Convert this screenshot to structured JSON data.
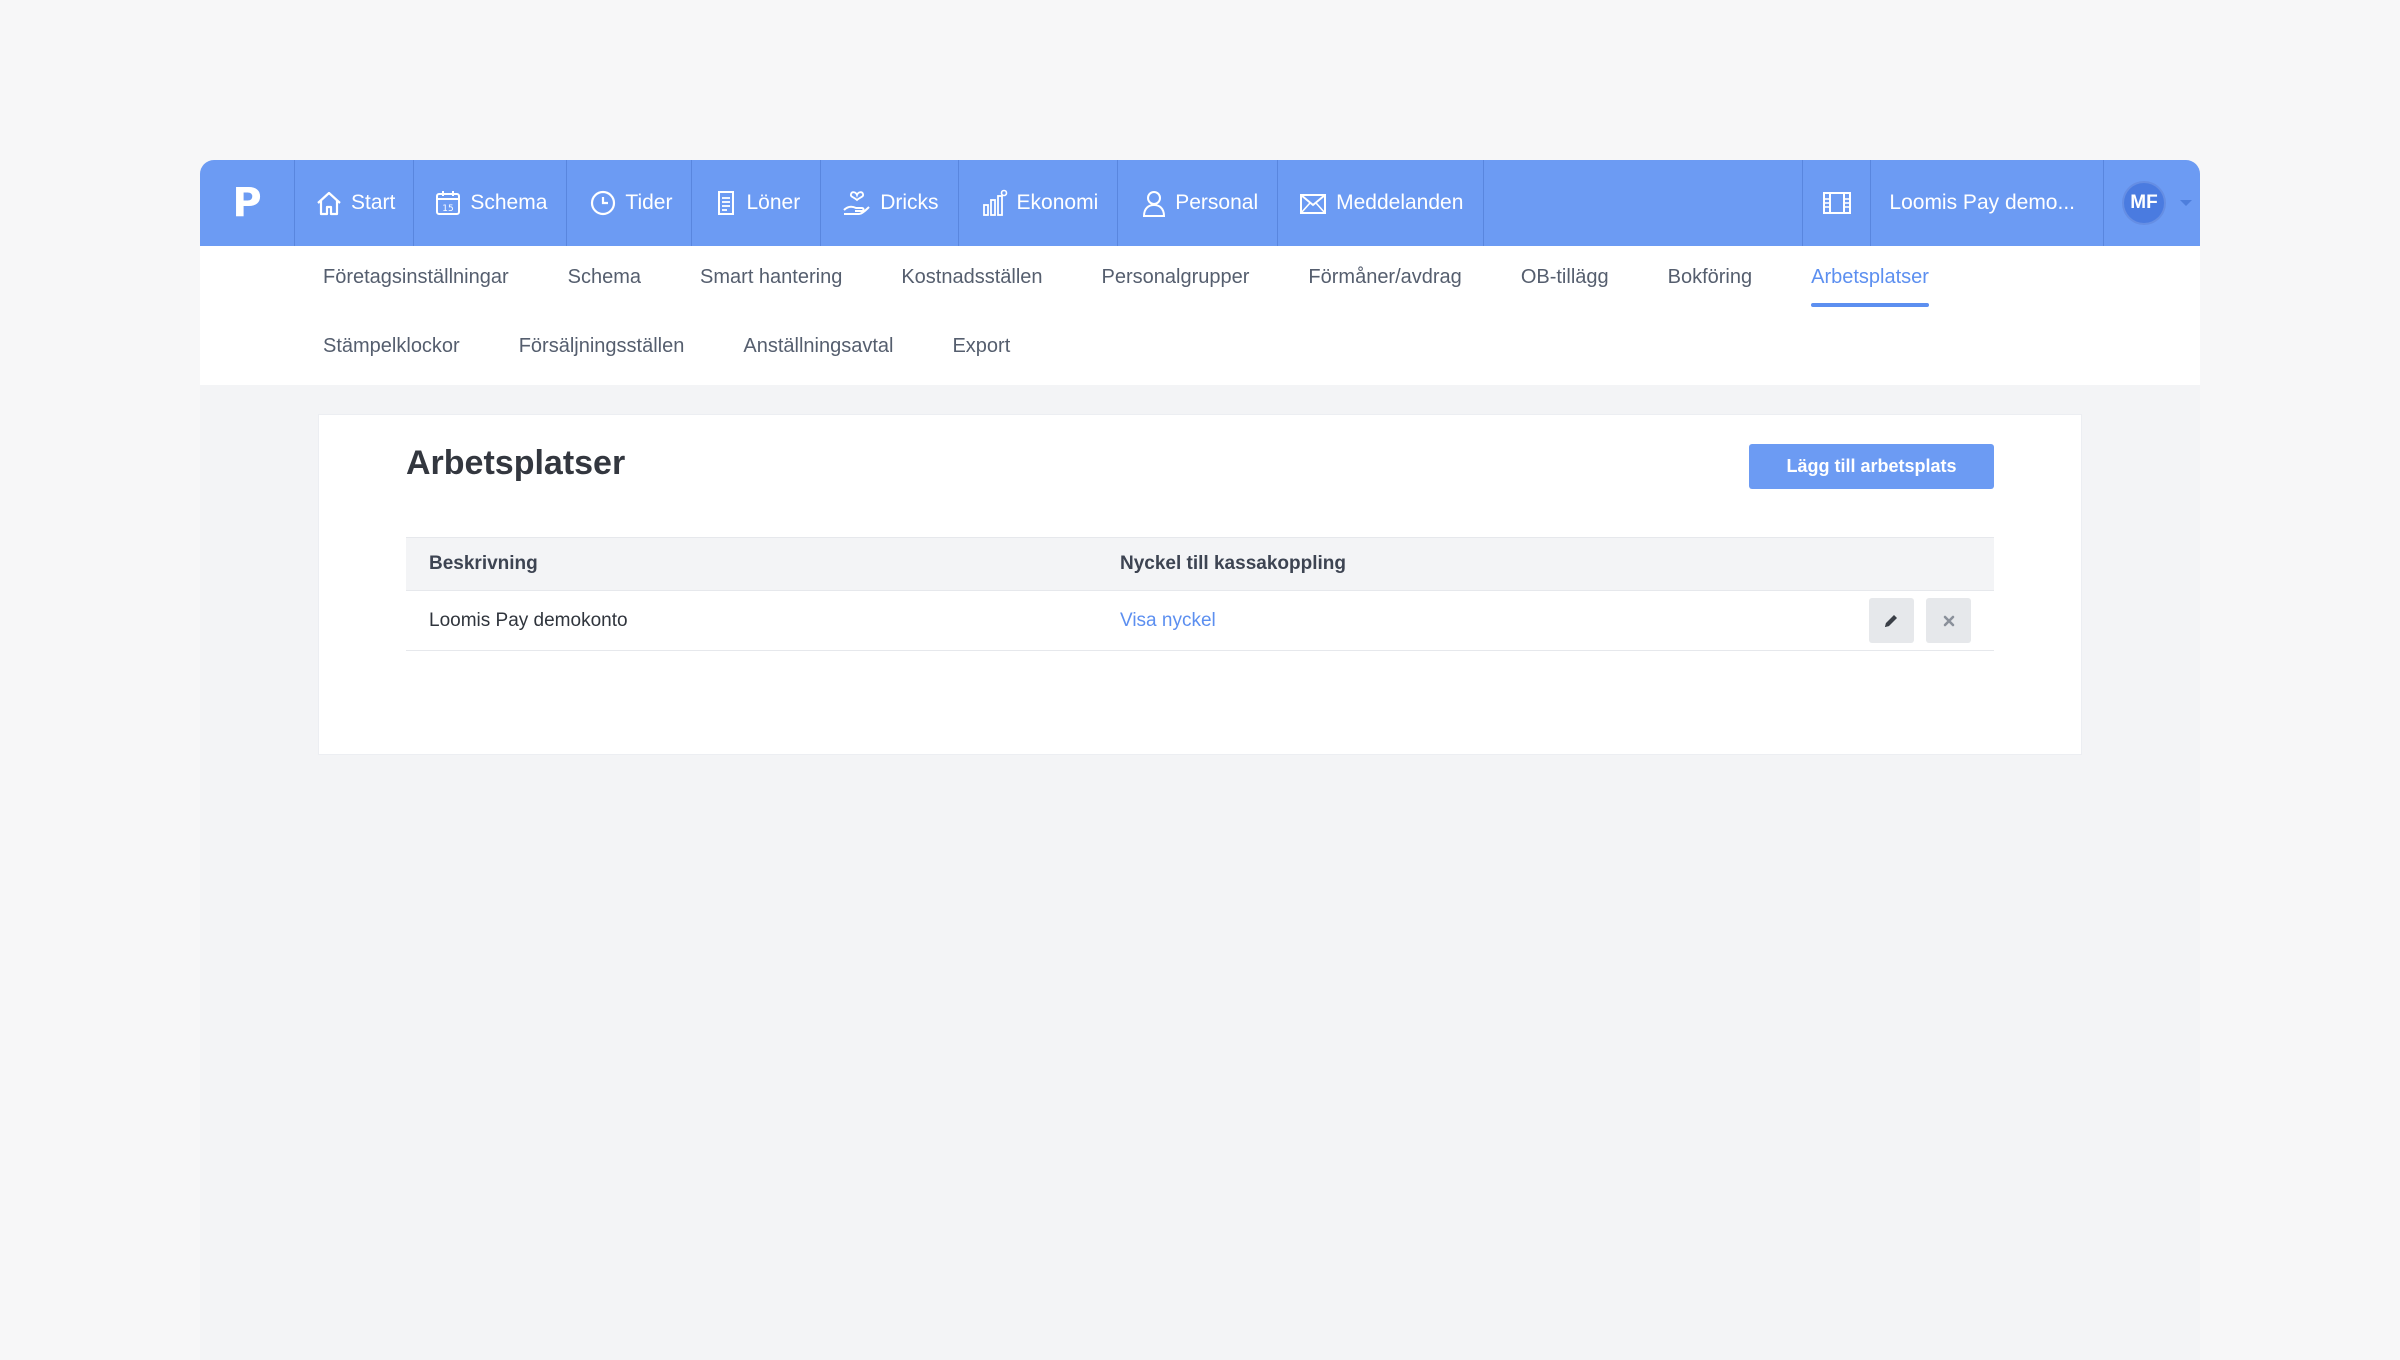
{
  "nav": {
    "logo": "P",
    "items": [
      {
        "label": "Start",
        "icon": "home-icon"
      },
      {
        "label": "Schema",
        "icon": "calendar-icon",
        "calendar_day": "15"
      },
      {
        "label": "Tider",
        "icon": "clock-icon"
      },
      {
        "label": "Löner",
        "icon": "document-icon"
      },
      {
        "label": "Dricks",
        "icon": "hand-heart-icon"
      },
      {
        "label": "Ekonomi",
        "icon": "bar-chart-icon"
      },
      {
        "label": "Personal",
        "icon": "person-icon"
      },
      {
        "label": "Meddelanden",
        "icon": "envelope-icon"
      }
    ],
    "film_icon": "film-icon",
    "company": "Loomis Pay demo...",
    "user_initials": "MF"
  },
  "subnav": {
    "row1": [
      "Företagsinställningar",
      "Schema",
      "Smart hantering",
      "Kostnadsställen",
      "Personalgrupper",
      "Förmåner/avdrag",
      "OB-tillägg",
      "Bokföring",
      "Arbetsplatser"
    ],
    "row2": [
      "Stämpelklockor",
      "Försäljningsställen",
      "Anställningsavtal",
      "Export"
    ],
    "active": "Arbetsplatser"
  },
  "page": {
    "title": "Arbetsplatser",
    "add_button": "Lägg till arbetsplats",
    "table": {
      "headers": [
        "Beskrivning",
        "Nyckel till kassakoppling"
      ],
      "rows": [
        {
          "description": "Loomis Pay demokonto",
          "key_link": "Visa nyckel"
        }
      ]
    }
  },
  "colors": {
    "primary": "#6c9bf3",
    "active_tab": "#5c8ff0",
    "avatar_bg": "#4a7be0"
  }
}
